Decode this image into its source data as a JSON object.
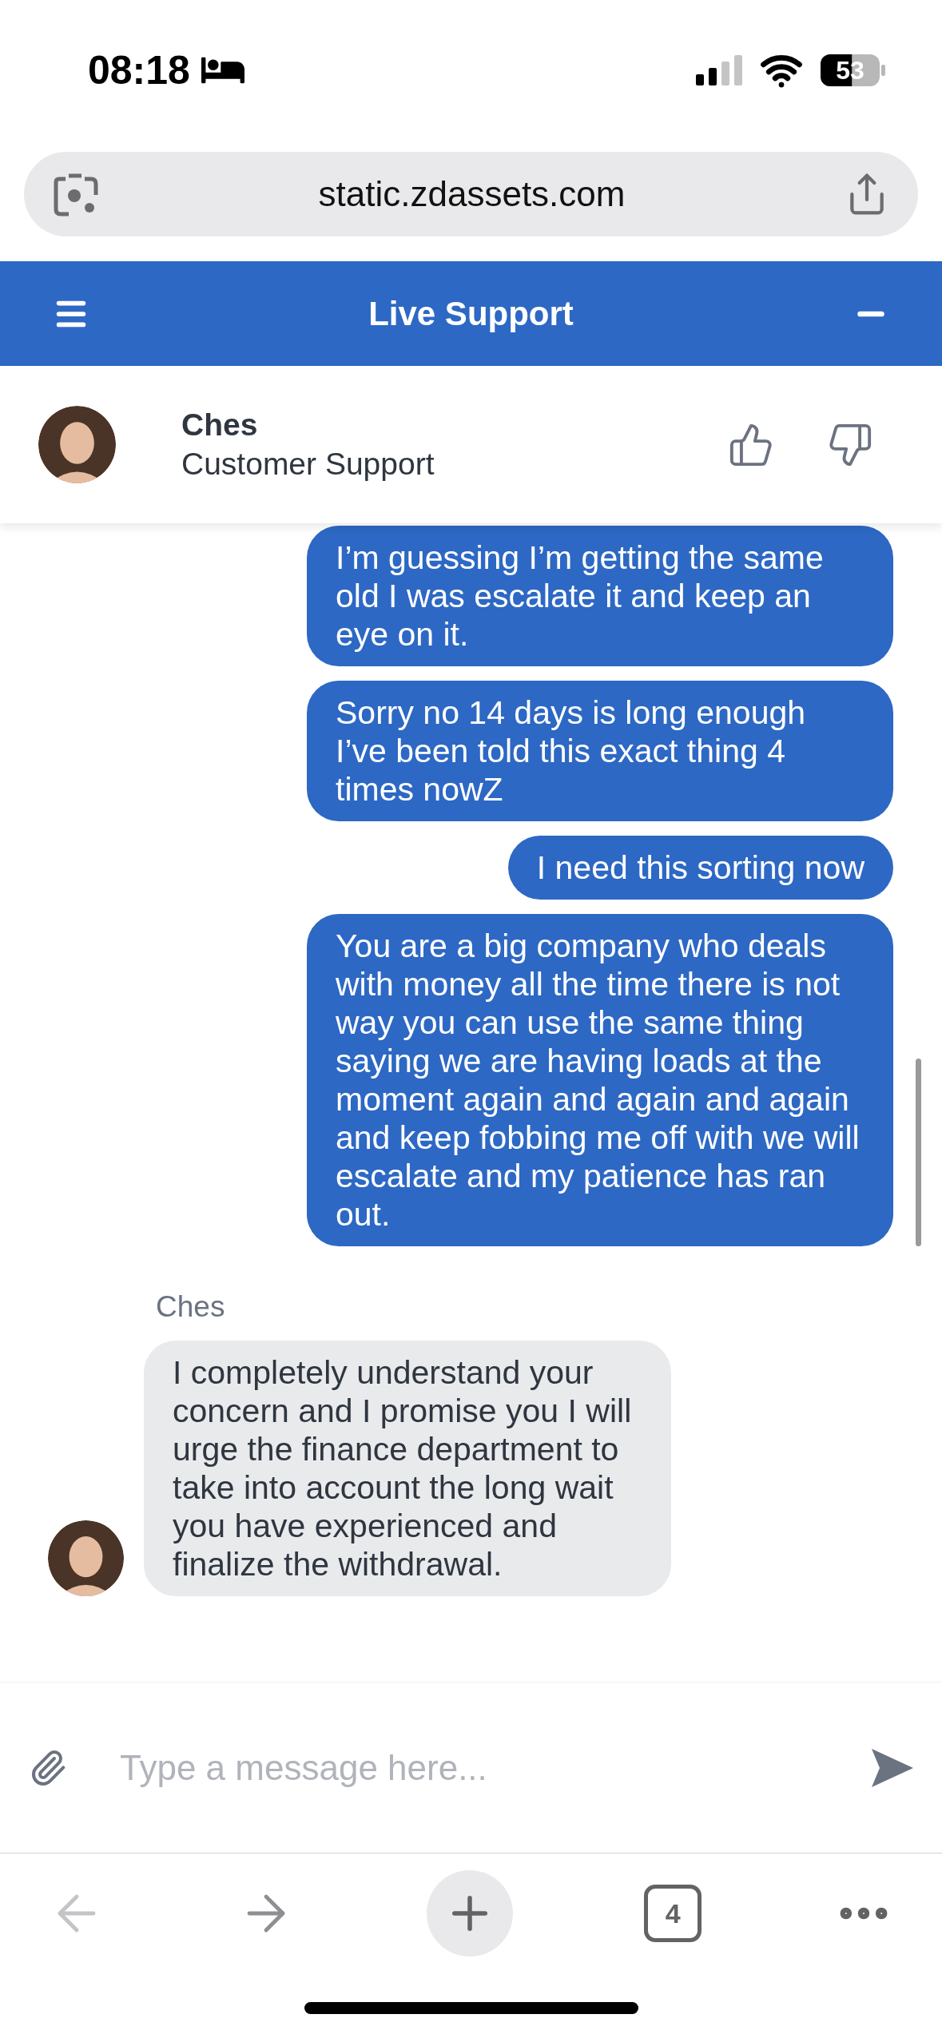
{
  "status_bar": {
    "time": "08:18",
    "battery": "53"
  },
  "browser": {
    "url": "static.zdassets.com"
  },
  "header": {
    "title": "Live Support"
  },
  "agent": {
    "name": "Ches",
    "role": "Customer Support"
  },
  "messages": [
    {
      "kind": "user",
      "text": "I’m guessing I’m getting the same old I was escalate it and keep an eye on it."
    },
    {
      "kind": "user",
      "text": "Sorry no 14 days is long enough I’ve been told this exact thing 4 times nowZ"
    },
    {
      "kind": "user",
      "text": "I need this sorting now"
    },
    {
      "kind": "user",
      "text": "You are a big company who deals with money all the time there is not way you can use the same thing saying we are having loads at the moment again and again and again and keep fobbing me off with we will escalate and my patience has ran out."
    },
    {
      "kind": "agent",
      "sender": "Ches",
      "text": "I completely understand your concern and I promise you I will urge the finance department to take into account the long wait you have experienced and finalize the withdrawal."
    }
  ],
  "composer": {
    "placeholder": "Type a message here..."
  },
  "toolbar": {
    "tab_count": "4"
  }
}
